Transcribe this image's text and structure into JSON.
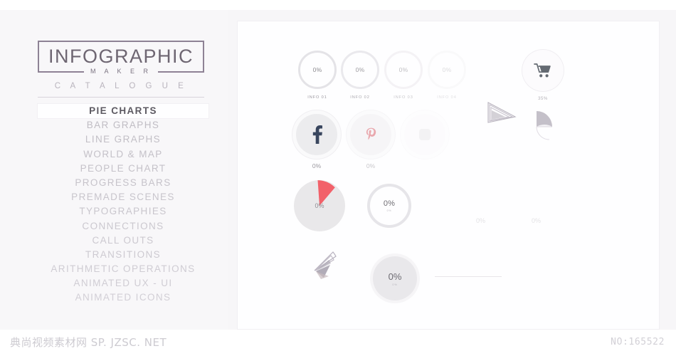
{
  "brand": {
    "title": "INFOGRAPHIC",
    "subtitle": "M A K E R",
    "section": "C A T A L O G U E"
  },
  "sidebar": {
    "items": [
      {
        "label": "PIE CHARTS",
        "active": true
      },
      {
        "label": "BAR GRAPHS",
        "active": false
      },
      {
        "label": "LINE GRAPHS",
        "active": false
      },
      {
        "label": "WORLD & MAP",
        "active": false
      },
      {
        "label": "PEOPLE CHART",
        "active": false
      },
      {
        "label": "PROGRESS BARS",
        "active": false
      },
      {
        "label": "PREMADE SCENES",
        "active": false
      },
      {
        "label": "TYPOGRAPHIES",
        "active": false
      },
      {
        "label": "CONNECTIONS",
        "active": false
      },
      {
        "label": "CALL OUTS",
        "active": false
      },
      {
        "label": "TRANSITIONS",
        "active": false
      },
      {
        "label": "ARITHMETIC OPERATIONS",
        "active": false
      },
      {
        "label": "ANIMATED UX - UI",
        "active": false
      },
      {
        "label": "ANIMATED ICONS",
        "active": false
      }
    ]
  },
  "watermarks": {
    "left": "典尚视频素材网  SP. JZSC. NET",
    "right": "NO:165522"
  },
  "colors": {
    "background": "#f7f6f8",
    "panel": "#fefeff",
    "brand_outline": "#8e8295",
    "menu_inactive": "#c3c0c7",
    "menu_active": "#5d5a62",
    "ring_track": "#e6e5e9",
    "accent_red": "#f2616a",
    "facebook_blue": "#3b4a63",
    "icon_gray": "#6e7278"
  },
  "chart_data": {
    "type": "pie",
    "title": "PIE CHARTS",
    "items": [
      {
        "id": "ring-1",
        "label": "INFO 01",
        "value": "0%",
        "numeric": 0,
        "style": "ring",
        "row": 1,
        "opacity": 1.0
      },
      {
        "id": "ring-2",
        "label": "INFO 02",
        "value": "0%",
        "numeric": 0,
        "style": "ring",
        "row": 1,
        "opacity": 0.85
      },
      {
        "id": "ring-3",
        "label": "INFO 03",
        "value": "0%",
        "numeric": 0,
        "style": "ring",
        "row": 1,
        "opacity": 0.55
      },
      {
        "id": "ring-4",
        "label": "INFO 04",
        "value": "0%",
        "numeric": 0,
        "style": "ring",
        "row": 1,
        "opacity": 0.28
      },
      {
        "id": "cart",
        "label": "35%",
        "value": "35%",
        "numeric": 35,
        "style": "icon-circle",
        "row": 1,
        "icon": "shopping-cart-icon",
        "opacity": 1.0
      },
      {
        "id": "social-1",
        "label": "0%",
        "value": "0%",
        "numeric": 0,
        "style": "icon-circle",
        "row": 2,
        "icon": "facebook-icon",
        "opacity": 1.0
      },
      {
        "id": "social-2",
        "label": "0%",
        "value": "0%",
        "numeric": 0,
        "style": "icon-circle",
        "row": 2,
        "icon": "pinterest-icon",
        "opacity": 0.7
      },
      {
        "id": "social-3",
        "label": "",
        "value": "",
        "numeric": 0,
        "style": "icon-circle",
        "row": 2,
        "icon": "dot-icon",
        "opacity": 0.22
      },
      {
        "id": "fan-1",
        "label": "",
        "value": "",
        "numeric": 0,
        "style": "fan",
        "row": 2,
        "opacity": 0.75
      },
      {
        "id": "fan-2",
        "label": "",
        "value": "",
        "numeric": 0,
        "style": "fan-half",
        "row": 2,
        "opacity": 0.75
      },
      {
        "id": "pie-1",
        "label": "0%",
        "value": "0%",
        "numeric": 0,
        "style": "pie-wedge",
        "row": 3,
        "opacity": 1.0
      },
      {
        "id": "donut-1",
        "label": "0%",
        "value": "0%",
        "numeric": 0,
        "style": "donut",
        "row": 3,
        "opacity": 1.0
      },
      {
        "id": "text-1",
        "label": "0%",
        "value": "0%",
        "numeric": 0,
        "style": "text-only",
        "row": 3,
        "opacity": 0.3
      },
      {
        "id": "text-2",
        "label": "0%",
        "value": "0%",
        "numeric": 0,
        "style": "text-only",
        "row": 3,
        "opacity": 0.3
      },
      {
        "id": "fan-3",
        "label": "",
        "value": "",
        "numeric": 0,
        "style": "fan",
        "row": 4,
        "opacity": 0.8
      },
      {
        "id": "solid-1",
        "label": "0%",
        "value": "0%",
        "numeric": 0,
        "style": "solid-circle",
        "row": 4,
        "opacity": 1.0
      },
      {
        "id": "rule-1",
        "label": "",
        "value": "",
        "numeric": 0,
        "style": "rule",
        "row": 4,
        "opacity": 0.45
      }
    ],
    "legend": [],
    "grid": false
  }
}
